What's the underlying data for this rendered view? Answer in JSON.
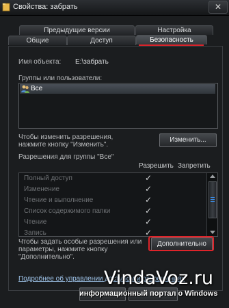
{
  "window": {
    "title": "Свойства: забрать"
  },
  "tabs_row1": [
    "Предыдущие версии",
    "Настройка"
  ],
  "tabs_row2": [
    "Общие",
    "Доступ",
    "Безопасность"
  ],
  "object": {
    "label": "Имя объекта:",
    "value": "E:\\забрать"
  },
  "groups": {
    "label": "Группы или пользователи:",
    "items": [
      "Все"
    ]
  },
  "change_hint": "Чтобы изменить разрешения,\nнажмите кнопку \"Изменить\".",
  "change_button": "Изменить...",
  "permissions": {
    "label": "Разрешения для группы \"Все\"",
    "allow_header": "Разрешить",
    "deny_header": "Запретить",
    "rows": [
      {
        "name": "Полный доступ",
        "allow": "✓",
        "deny": ""
      },
      {
        "name": "Изменение",
        "allow": "✓",
        "deny": ""
      },
      {
        "name": "Чтение и выполнение",
        "allow": "✓",
        "deny": ""
      },
      {
        "name": "Список содержимого папки",
        "allow": "✓",
        "deny": ""
      },
      {
        "name": "Чтение",
        "allow": "✓",
        "deny": ""
      },
      {
        "name": "Запись",
        "allow": "✓",
        "deny": ""
      }
    ]
  },
  "special_hint": "Чтобы задать особые разрешения или\nпараметры, нажмите кнопку\n\"Дополнительно\".",
  "advanced_button": "Дополнительно",
  "help_link": "Подробнее об управлении доступом и разрешениях",
  "watermark": {
    "site": "VindaVoz.ru",
    "tagline": "информационный портал о Windows"
  },
  "bottom_buttons": [
    "ОК",
    "Отмена"
  ],
  "colors": {
    "accent_red": "#d9232a",
    "background": "#1b1d1f"
  }
}
